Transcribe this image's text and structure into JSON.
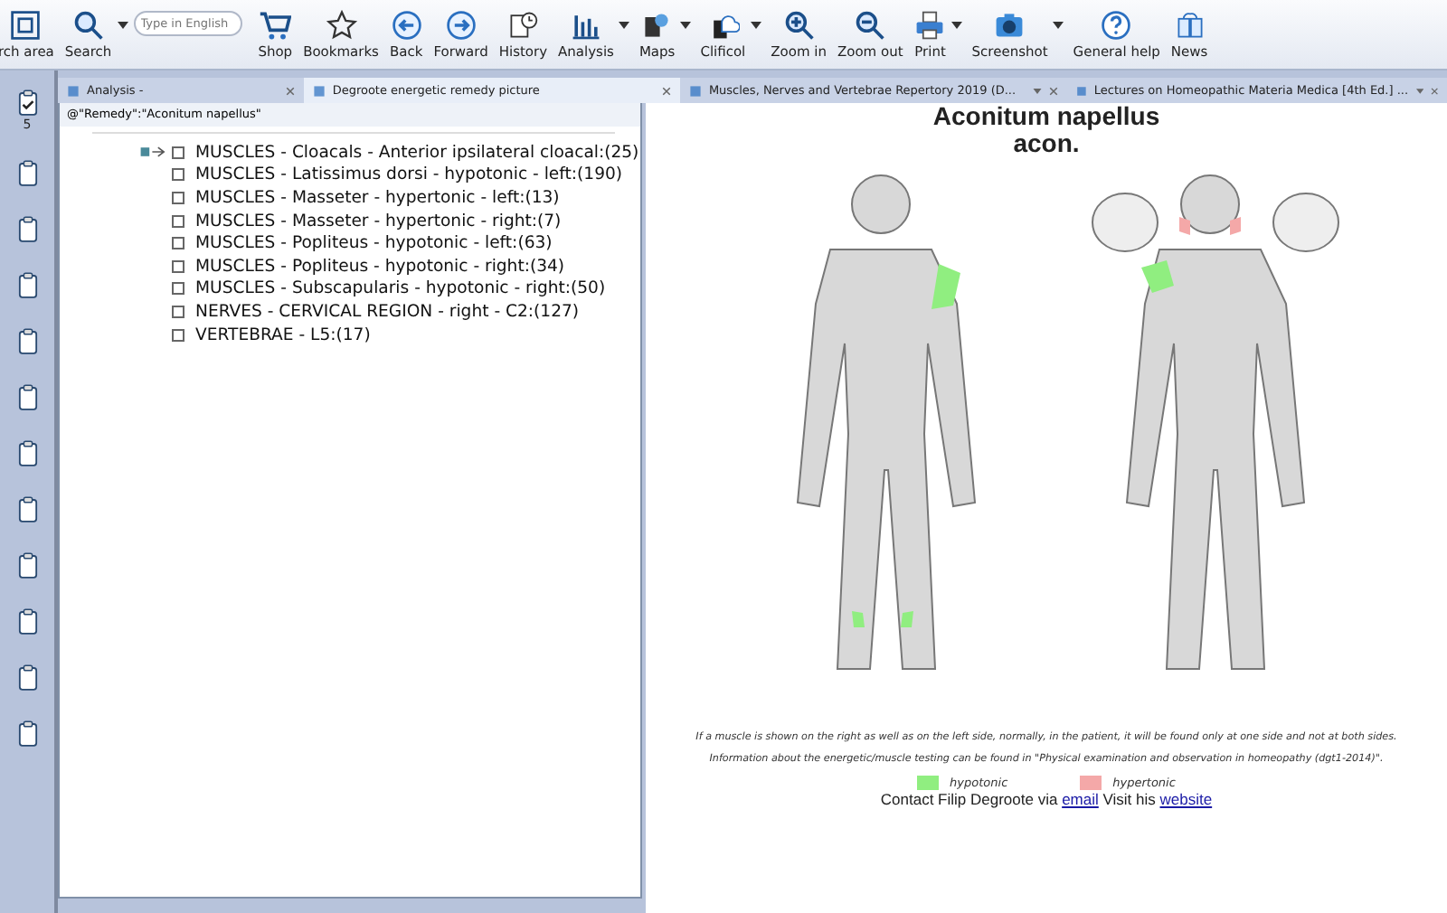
{
  "toolbar": {
    "items": [
      {
        "kind": "button",
        "label": "rch area",
        "dropdown": false
      },
      {
        "kind": "button",
        "label": "Search",
        "dropdown": true
      },
      {
        "kind": "field",
        "placeholder": "Type in English"
      },
      {
        "kind": "button",
        "label": "Shop",
        "dropdown": false
      },
      {
        "kind": "button",
        "label": "Bookmarks",
        "dropdown": false
      },
      {
        "kind": "button",
        "label": "Back",
        "dropdown": false
      },
      {
        "kind": "button",
        "label": "Forward",
        "dropdown": false
      },
      {
        "kind": "button",
        "label": "History",
        "dropdown": false
      },
      {
        "kind": "button",
        "label": "Analysis",
        "dropdown": true
      },
      {
        "kind": "button",
        "label": "Maps",
        "dropdown": true
      },
      {
        "kind": "button",
        "label": "Clificol",
        "dropdown": true
      },
      {
        "kind": "button",
        "label": "Zoom in",
        "dropdown": false
      },
      {
        "kind": "button",
        "label": "Zoom out",
        "dropdown": false
      },
      {
        "kind": "button",
        "label": "Print",
        "dropdown": true
      },
      {
        "kind": "button",
        "label": "Screenshot",
        "dropdown": true
      },
      {
        "kind": "button",
        "label": "General help",
        "dropdown": false
      },
      {
        "kind": "button",
        "label": "News",
        "dropdown": false
      }
    ]
  },
  "clipboards": [
    {
      "checked": true,
      "count": "5"
    },
    {
      "checked": false
    },
    {
      "checked": false
    },
    {
      "checked": false
    },
    {
      "checked": false
    },
    {
      "checked": false
    },
    {
      "checked": false
    },
    {
      "checked": false
    },
    {
      "checked": false
    },
    {
      "checked": false
    },
    {
      "checked": false
    },
    {
      "checked": false
    }
  ],
  "tabs": [
    {
      "label": "Analysis -",
      "selected": false,
      "menu": false
    },
    {
      "label": "Degroote energetic remedy picture",
      "selected": true,
      "menu": false
    },
    {
      "label": "Muscles, Nerves and Vertebrae Repertory 2019 (D...",
      "selected": false,
      "menu": true
    },
    {
      "label": "Lectures on Homeopathic Materia Medica [4th Ed.] ...",
      "selected": false,
      "menu": true
    }
  ],
  "analysis": {
    "query": "@\"Remedy\":\"Aconitum napellus\"",
    "rubrics": [
      {
        "text": "MUSCLES - Cloacals - Anterior ipsilateral cloacal:(25)",
        "checked": false
      },
      {
        "text": "MUSCLES - Latissimus dorsi - hypotonic - left:(190)",
        "checked": false
      },
      {
        "text": "MUSCLES - Masseter - hypertonic - left:(13)",
        "checked": false
      },
      {
        "text": "MUSCLES - Masseter - hypertonic - right:(7)",
        "checked": false
      },
      {
        "text": "MUSCLES - Popliteus - hypotonic - left:(63)",
        "checked": false
      },
      {
        "text": "MUSCLES - Popliteus - hypotonic - right:(34)",
        "checked": false
      },
      {
        "text": "MUSCLES - Subscapularis - hypotonic - right:(50)",
        "checked": false
      },
      {
        "text": "NERVES - CERVICAL REGION - right - C2:(127)",
        "checked": false
      },
      {
        "text": "VERTEBRAE - L5:(17)",
        "checked": false
      }
    ]
  },
  "picture": {
    "title": "Aconitum napellus",
    "abbreviation": "acon.",
    "notes": [
      "If a muscle is shown on the right as well as on the left side, normally, in the patient, it will be found only at one side and not at both sides.",
      "Information about the energetic/muscle testing can be found in \"Physical examination and observation in homeopathy (dgt1-2014)\"."
    ],
    "legend": [
      {
        "label": "hypotonic",
        "color": "#90ee80"
      },
      {
        "label": "hypertonic",
        "color": "#f4a8a8"
      }
    ],
    "contact": {
      "before": "Contact Filip Degroote via",
      "email_link": "email",
      "middle": "Visit his",
      "website_link": "website"
    }
  }
}
